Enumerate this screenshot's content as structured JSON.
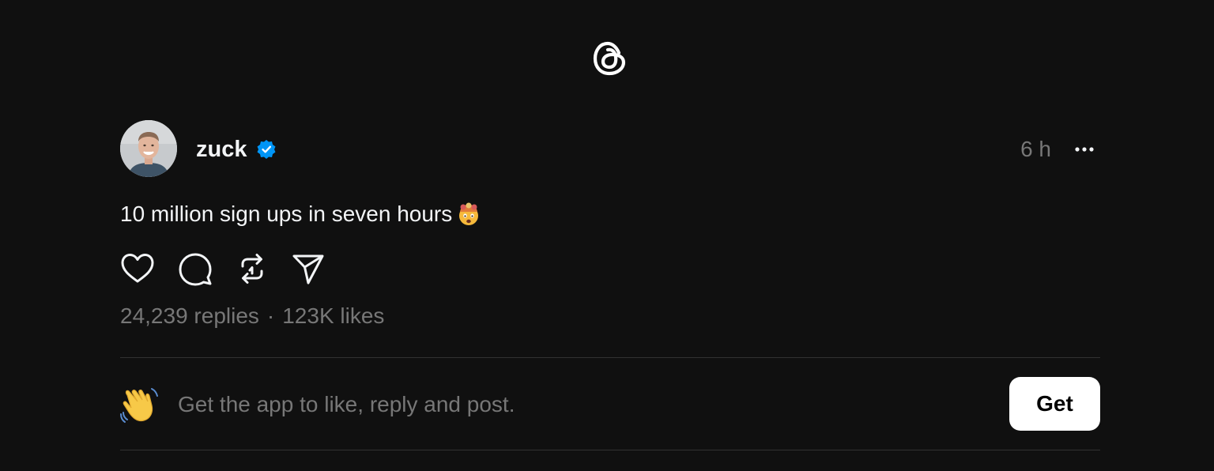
{
  "app": {
    "logo_icon": "threads-logo-icon"
  },
  "post": {
    "username": "zuck",
    "verified_icon": "verified-badge-icon",
    "time": "6 h",
    "more_icon": "more-horizontal-icon",
    "text": "10 million sign ups in seven hours",
    "emoji": "exploding-head-emoji",
    "actions": [
      {
        "name": "like",
        "icon": "heart-icon"
      },
      {
        "name": "reply",
        "icon": "comment-icon"
      },
      {
        "name": "repost",
        "icon": "repost-icon"
      },
      {
        "name": "share",
        "icon": "send-icon"
      }
    ],
    "replies": "24,239 replies",
    "separator": "·",
    "likes": "123K likes"
  },
  "cta": {
    "icon": "waving-hand-emoji",
    "text": "Get the app to like, reply and post.",
    "button_label": "Get"
  },
  "colors": {
    "background": "#101010",
    "text": "#f3f5f7",
    "muted": "#777777",
    "verified": "#0095f6",
    "button_bg": "#ffffff"
  }
}
